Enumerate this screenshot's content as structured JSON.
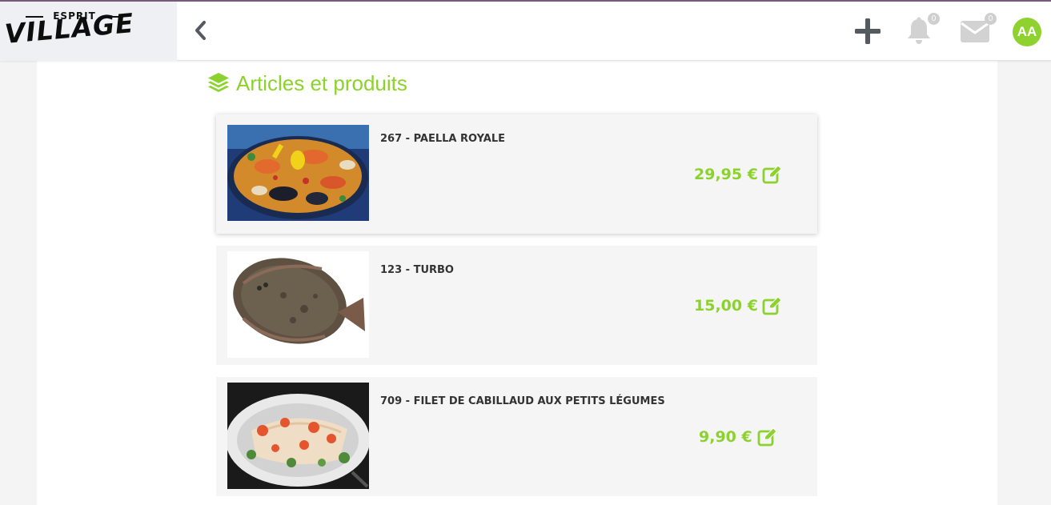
{
  "brand": {
    "logo_top": "ESPRIT",
    "logo_main": "VILLAGE"
  },
  "header": {
    "back_icon": "chevron-left-icon",
    "add_icon": "plus-icon",
    "notifications": {
      "icon": "bell-icon",
      "count": "0"
    },
    "messages": {
      "icon": "envelope-icon",
      "count": "0"
    },
    "avatar_initials": "AA"
  },
  "page": {
    "title": "Articles et produits",
    "title_icon": "layers-icon"
  },
  "products": [
    {
      "name": "267 - PAELLA ROYALE",
      "price": "29,95 €",
      "image": "paella-photo",
      "edit_icon": "edit-icon"
    },
    {
      "name": "123 - TURBO",
      "price": "15,00 €",
      "image": "turbot-fish-photo",
      "edit_icon": "edit-icon"
    },
    {
      "name": "709 - FILET DE CABILLAUD AUX PETITS LÉGUMES",
      "price": "9,90 €",
      "image": "cod-fillet-photo",
      "edit_icon": "edit-icon"
    }
  ],
  "colors": {
    "accent": "#8cd22c",
    "text": "#333333",
    "header_bg": "#ffffff",
    "card_bg": "#f5f5f5",
    "icon_gray": "#555a61"
  }
}
